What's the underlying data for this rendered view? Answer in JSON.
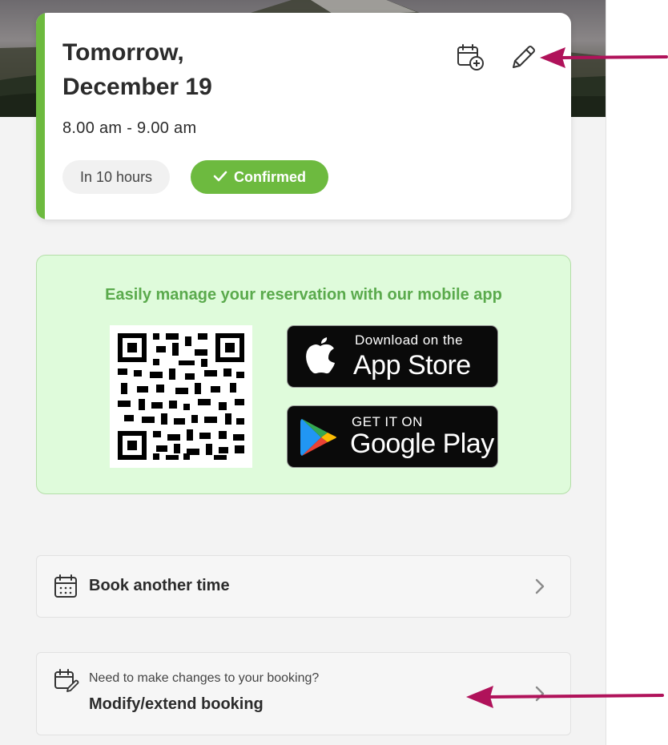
{
  "booking": {
    "title_line1": "Tomorrow,",
    "title_line2": "December 19",
    "time_range": "8.00 am - 9.00 am",
    "relative_time": "In 10 hours",
    "status": "Confirmed",
    "accent_color": "#6dba3f",
    "actions": [
      "calendar-add-icon",
      "pencil-icon"
    ]
  },
  "app_promo": {
    "heading": "Easily manage your reservation with our mobile app",
    "app_store": {
      "small": "Download on the",
      "big": "App Store"
    },
    "google_play": {
      "small": "GET IT ON",
      "big": "Google Play"
    }
  },
  "actions": {
    "book_another": {
      "label": "Book another time",
      "icon": "calendar-icon"
    },
    "modify": {
      "subtitle": "Need to make changes to your booking?",
      "label": "Modify/extend booking",
      "icon": "calendar-edit-icon"
    }
  },
  "annotation_color": "#b0125a"
}
